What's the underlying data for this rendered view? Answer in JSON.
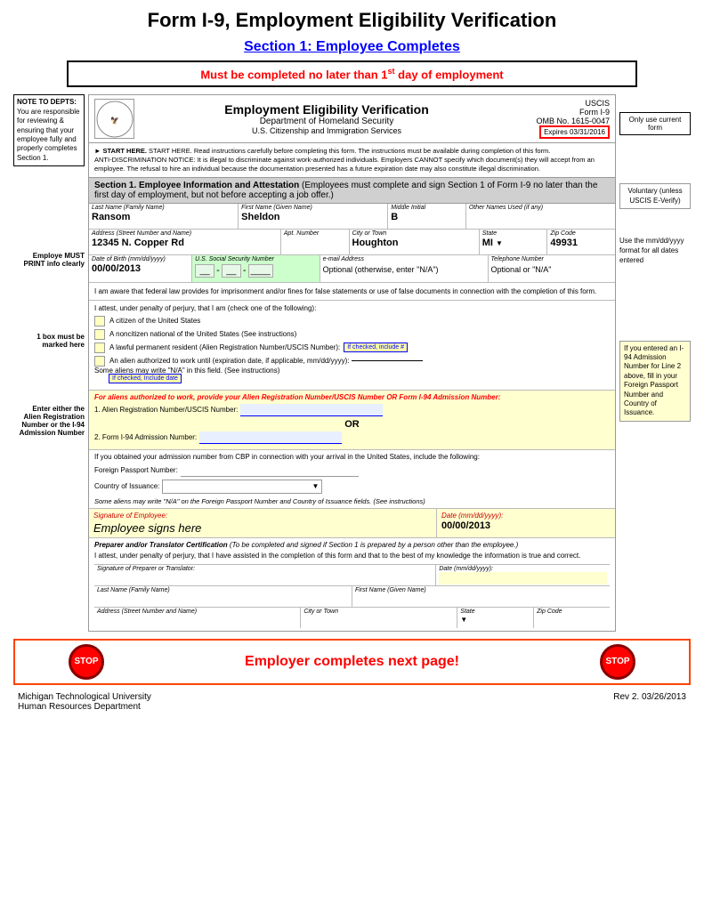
{
  "page": {
    "main_title": "Form I-9, Employment Eligibility Verification",
    "section_title": "Section 1: Employee Completes",
    "must_complete": "Must be completed no later than 1",
    "must_complete_sup": "st",
    "must_complete_suffix": " day of employment",
    "note_to_depts_label": "NOTE TO DEPTS:",
    "note_to_depts_text": "You are responsible for reviewing & ensuring that your employee fully and properly completes Section 1.",
    "form_title": "Employment Eligibility Verification",
    "form_dept": "Department of Homeland Security",
    "form_agency": "U.S. Citizenship and Immigration Services",
    "uscis_label": "USCIS",
    "form_number": "Form I-9",
    "omb_label": "OMB No. 1615-0047",
    "expires_label": "Expires 03/31/2016",
    "only_use_label": "Only use current form",
    "start_here_text": "START HERE. Read instructions carefully before completing this form. The instructions must be available during completion of this form.",
    "anti_discrimination": "ANTI-DISCRIMINATION NOTICE: It is illegal to discriminate against work-authorized individuals. Employers CANNOT specify which document(s) they will accept from an employee. The refusal to hire an individual because the documentation presented has a future expiration date may also constitute illegal discrimination.",
    "section1_header": "Section 1. Employee Information and Attestation",
    "section1_subtitle": "(Employees must complete and sign Section 1 of Form I-9 no later than the first day of employment, but not before accepting a job offer.)",
    "field_last_name": "Last Name (Family Name)",
    "field_first_name": "First Name (Given Name)",
    "field_middle_initial": "Middle Initial",
    "field_other_names": "Other Names Used (if any)",
    "value_last_name": "Ransom",
    "value_first_name": "Sheldon",
    "value_middle_initial": "B",
    "field_address": "Address (Street Number and Name)",
    "value_address": "12345 N. Copper Rd",
    "field_apt": "Apt. Number",
    "field_city": "City or Town",
    "value_city": "Houghton",
    "field_state": "State",
    "value_state": "MI",
    "field_zip": "Zip Code",
    "value_zip": "49931",
    "field_dob": "Date of Birth (mm/dd/yyyy)",
    "value_dob": "00/00/2013",
    "field_ssn": "U.S. Social Security Number",
    "field_email": "e-mail Address",
    "value_email": "Optional (otherwise, enter \"N/A\")",
    "field_phone": "Telephone Number",
    "value_phone": "Optional or \"N/A\"",
    "attestation_text": "I am aware that federal law provides for imprisonment and/or fines for false statements or use of false documents in connection with the completion of this form.",
    "attest_header": "I attest, under penalty of perjury, that I am (check one of the following):",
    "checkbox1": "A citizen of the United States",
    "checkbox2": "A noncitizen national of the United States (See instructions)",
    "checkbox3": "A lawful permanent resident (Alien Registration Number/USCIS Number):",
    "if_checked_include": "If checked, include #",
    "checkbox4_part1": "An alien authorized to work until (expiration date, if applicable, mm/dd/yyyy):",
    "if_checked_date": "If checked, Include date",
    "checkbox4_note": "Some aliens may write \"N/A\" in this field. (See instructions)",
    "for_aliens_text": "For aliens authorized to work, provide your Alien Registration Number/USCIS Number OR Form I-94 Admission Number:",
    "alien_reg_label": "1. Alien Registration Number/USCIS Number:",
    "or_text": "OR",
    "form_i94_label": "2. Form I-94 Admission Number:",
    "admission_text": "If you obtained your admission number from CBP in connection with your arrival in the United States, include the following:",
    "foreign_passport_label": "Foreign Passport Number:",
    "country_issuance_label": "Country of Issuance:",
    "aliens_na_note": "Some aliens may write \"N/A\" on the Foreign Passport Number and Country of Issuance fields. (See instructions)",
    "sig_employee_label": "Signature of Employee:",
    "sig_employee_value": "Employee signs here",
    "sig_date_label": "Date (mm/dd/yyyy):",
    "sig_date_value": "00/00/2013",
    "preparer_header": "Preparer and/or Translator Certification",
    "preparer_subtitle": "(To be completed and signed if Section 1 is prepared by a person other than the employee.)",
    "preparer_attest": "I attest, under penalty of perjury, that I have assisted in the completion of this form and that to the best of my knowledge the information is true and correct.",
    "prep_sig_label": "Signature of Preparer or Translator:",
    "prep_date_label": "Date (mm/dd/yyyy):",
    "prep_last_name_label": "Last Name (Family Name)",
    "prep_first_name_label": "First Name (Given Name)",
    "prep_address_label": "Address (Street Number and Name)",
    "prep_city_label": "City or Town",
    "prep_state_label": "State",
    "prep_zip_label": "Zip Code",
    "employer_next": "Employer completes next page!",
    "stop_text": "STOP",
    "footer_university": "Michigan Technological University",
    "footer_dept": "Human Resources Department",
    "footer_rev": "Rev 2. 03/26/2013",
    "employee_must_print": "Employe MUST PRINT info clearly",
    "one_box_marked": "1 box must be marked here",
    "enter_alien": "Enter either the Alien Registration Number or the I-94 Admission Number",
    "use_mm_dd_yyyy": "Use the mm/dd/yyyy format for all dates entered",
    "voluntary_text": "Voluntary (unless USCIS E-Verify)",
    "i94_popup_text": "If you entered an I-94 Admission Number for Line 2 above, fill in your Foreign Passport Number and Country of Issuance."
  }
}
